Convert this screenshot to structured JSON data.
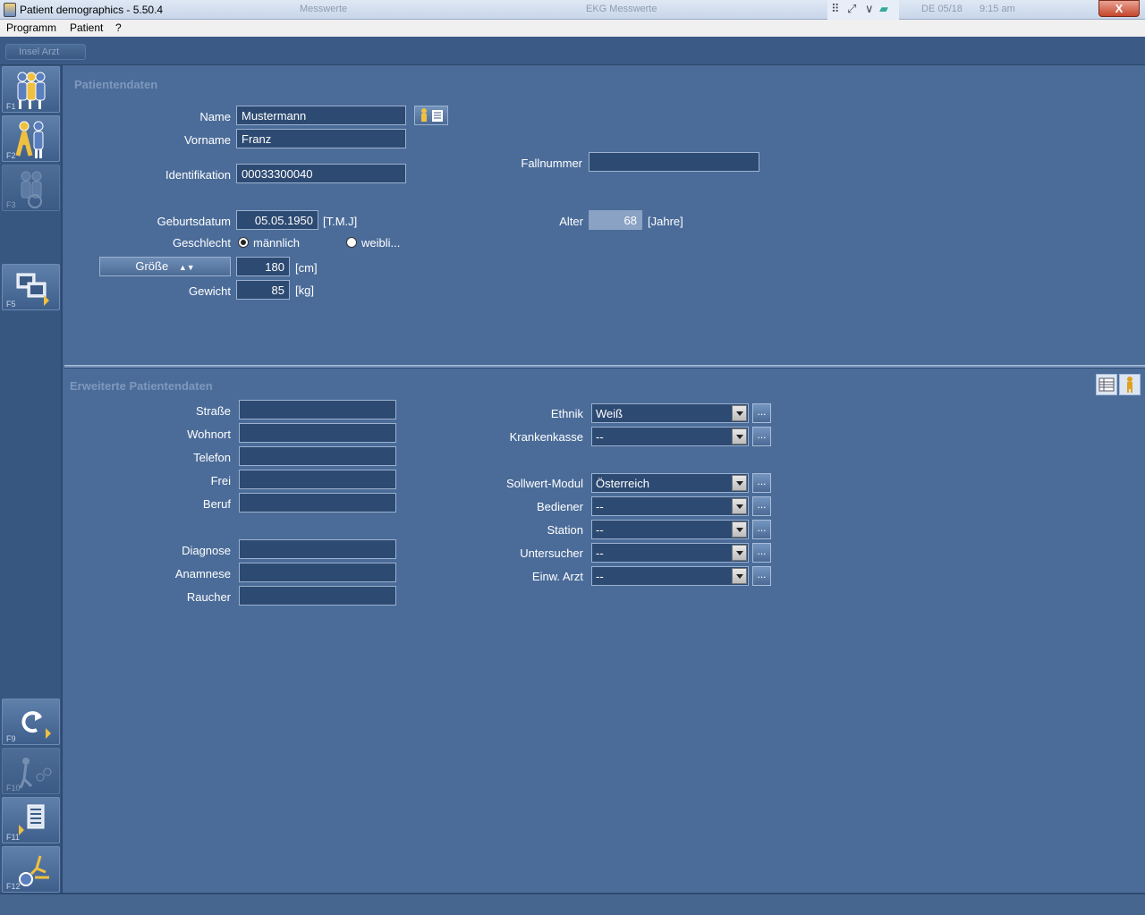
{
  "window": {
    "title": "Patient demographics - 5.50.4",
    "close_label": "X",
    "ghost_texts": [
      "Messwerte",
      "EKG Messwerte",
      "DE 05/18",
      "9:15 am"
    ]
  },
  "menu": {
    "items": [
      "Programm",
      "Patient",
      "?"
    ]
  },
  "strip": {
    "label": "Insel Arzt"
  },
  "toolbar": {
    "buttons": [
      {
        "fkey": "F1",
        "icon": "patients-group-icon"
      },
      {
        "fkey": "F2",
        "icon": "patient-walking-icon"
      },
      {
        "fkey": "F3",
        "icon": "patient-seated-icon"
      },
      {
        "fkey": "F5",
        "icon": "monitor-transfer-icon"
      },
      {
        "fkey": "F9",
        "icon": "undo-arrow-icon"
      },
      {
        "fkey": "F10",
        "icon": "exercise-icon"
      },
      {
        "fkey": "F11",
        "icon": "list-export-icon"
      },
      {
        "fkey": "F12",
        "icon": "home-exit-icon"
      }
    ]
  },
  "patient": {
    "section_title": "Patientendaten",
    "name_label": "Name",
    "name_value": "Mustermann",
    "vorname_label": "Vorname",
    "vorname_value": "Franz",
    "id_label": "Identifikation",
    "id_value": "00033300040",
    "fallnummer_label": "Fallnummer",
    "fallnummer_value": "",
    "geburtsdatum_label": "Geburtsdatum",
    "geburtsdatum_value": "05.05.1950",
    "geburtsdatum_unit": "[T.M.J]",
    "alter_label": "Alter",
    "alter_value": "68",
    "alter_unit": "[Jahre]",
    "geschlecht_label": "Geschlecht",
    "male_label": "männlich",
    "female_label": "weibli...",
    "selected_gender": "männlich",
    "groesse_button": "Größe",
    "groesse_value": "180",
    "groesse_unit": "[cm]",
    "gewicht_label": "Gewicht",
    "gewicht_value": "85",
    "gewicht_unit": "[kg]"
  },
  "extended": {
    "section_title": "Erweiterte Patientendaten",
    "left_fields": [
      {
        "label": "Straße",
        "value": ""
      },
      {
        "label": "Wohnort",
        "value": ""
      },
      {
        "label": "Telefon",
        "value": ""
      },
      {
        "label": "Frei",
        "value": ""
      },
      {
        "label": "Beruf",
        "value": ""
      },
      {
        "label": "Diagnose",
        "value": ""
      },
      {
        "label": "Anamnese",
        "value": ""
      },
      {
        "label": "Raucher",
        "value": ""
      }
    ],
    "combos": [
      {
        "label": "Ethnik",
        "value": "Weiß"
      },
      {
        "label": "Krankenkasse",
        "value": "--"
      },
      {
        "label": "Sollwert-Modul",
        "value": "Österreich"
      },
      {
        "label": "Bediener",
        "value": "--"
      },
      {
        "label": "Station",
        "value": "--"
      },
      {
        "label": "Untersucher",
        "value": "--"
      },
      {
        "label": "Einw. Arzt",
        "value": "--"
      }
    ],
    "dots_label": "..."
  }
}
